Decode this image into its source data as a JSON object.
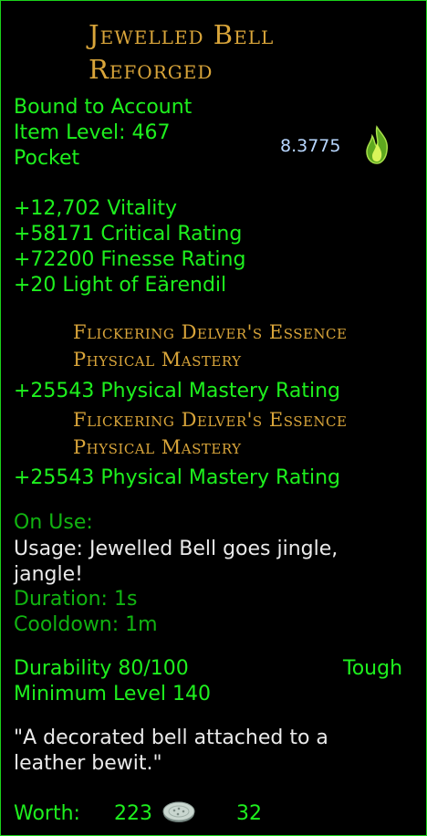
{
  "item": {
    "title_line1": "Jewelled Bell",
    "title_line2": "Reforged",
    "binding": "Bound to Account",
    "item_level": "Item Level: 467",
    "slot": "Pocket",
    "rating_value": "8.3775",
    "stats": [
      "+12,702 Vitality",
      "+58171 Critical Rating",
      "+72200 Finesse Rating",
      "+20 Light of Eärendil"
    ],
    "essences": [
      {
        "name": "Flickering Delver's Essence",
        "type": "Physical Mastery",
        "bonus": "+25543 Physical Mastery Rating"
      },
      {
        "name": "Flickering Delver's Essence",
        "type": "Physical Mastery",
        "bonus": "+25543 Physical Mastery Rating"
      }
    ],
    "on_use": {
      "header": "On Use:",
      "usage_line1": "Usage: Jewelled Bell goes jingle,",
      "usage_line2": "jangle!",
      "duration": "Duration: 1s",
      "cooldown": "Cooldown: 1m"
    },
    "durability": "Durability 80/100",
    "durability_type": "Tough",
    "min_level": "Minimum Level 140",
    "description_line1": "\"A decorated bell attached to a",
    "description_line2": "leather bewit.\"",
    "worth_label": "Worth:",
    "worth_silver": "223",
    "worth_copper": "32"
  },
  "icons": {
    "rating_icon": "green-flame-icon",
    "coin_icon": "silver-coin-icon"
  },
  "colors": {
    "title": "#d9a53a",
    "text_green": "#1ef01e",
    "white": "#eaeaea",
    "border": "#1bd21b"
  }
}
